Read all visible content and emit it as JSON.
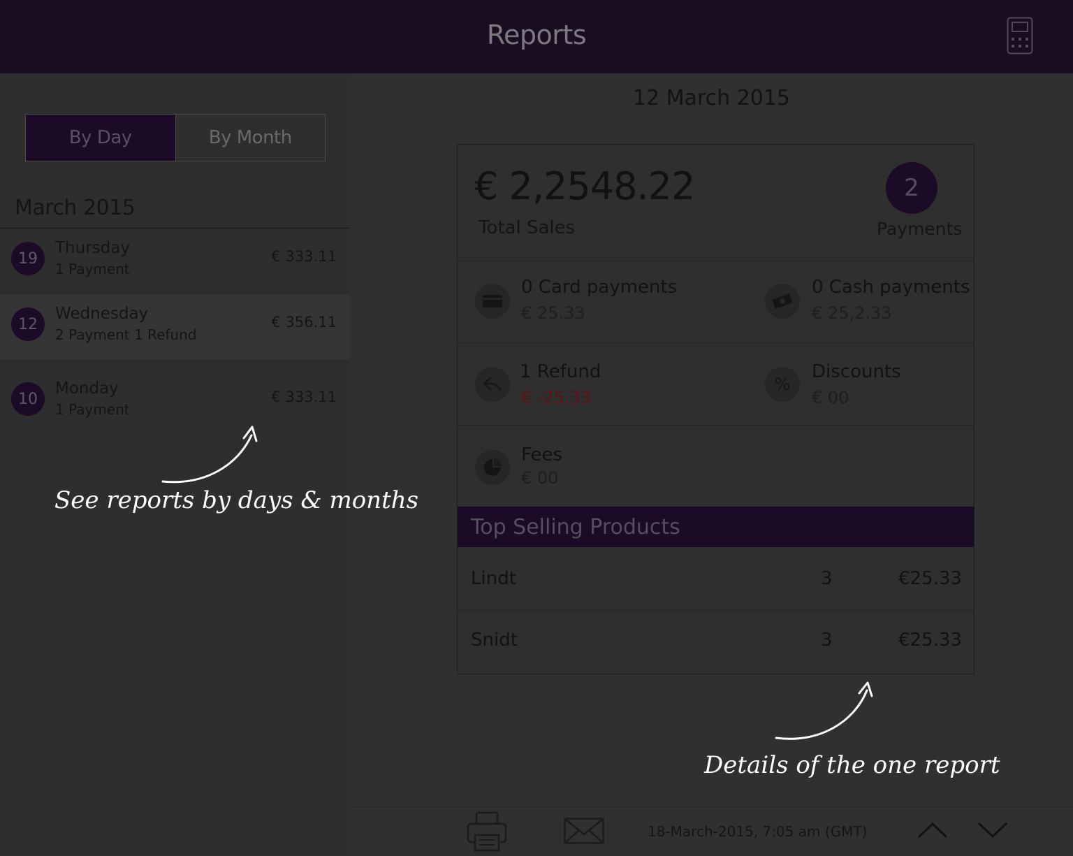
{
  "header": {
    "title": "Reports",
    "device_icon": "card-reader-icon"
  },
  "sidebar": {
    "toggle": {
      "by_day": "By Day",
      "by_month": "By Month",
      "active": "By Day"
    },
    "month": "March 2015",
    "days": [
      {
        "date": "19",
        "weekday": "Thursday",
        "summary": "1 Payment",
        "amount": "€ 333.11"
      },
      {
        "date": "12",
        "weekday": "Wednesday",
        "summary": "2 Payment 1 Refund",
        "amount": "€ 356.11"
      },
      {
        "date": "10",
        "weekday": "Monday",
        "summary": "1 Payment",
        "amount": "€ 333.11"
      }
    ],
    "annotation": "See reports by days & months"
  },
  "report": {
    "date": "12 March 2015",
    "total_amount": "€ 2,2548.22",
    "total_label": "Total Sales",
    "payments_count": "2",
    "payments_label": "Payments",
    "card": {
      "title": "0 Card payments",
      "value": "€ 25.33",
      "icon": "credit-card-icon"
    },
    "cash": {
      "title": "0 Cash payments",
      "value": "€ 25,2.33",
      "icon": "cash-icon"
    },
    "refund": {
      "title": "1 Refund",
      "value": "€ -25.33",
      "icon": "refund-arrow-icon",
      "value_color": "#5e1313"
    },
    "discounts": {
      "title": "Discounts",
      "value": "€ 00",
      "icon": "percent-icon"
    },
    "fees": {
      "title": "Fees",
      "value": "€ 00",
      "icon": "pie-chart-icon"
    },
    "top_selling_title": "Top Selling Products",
    "products": [
      {
        "name": "Lindt",
        "qty": "3",
        "price": "€25.33"
      },
      {
        "name": "Snidt",
        "qty": "3",
        "price": "€25.33"
      }
    ],
    "annotation": "Details of the one report"
  },
  "footer": {
    "timestamp": "18-March-2015, 7:05 am (GMT)",
    "print_icon": "printer-icon",
    "email_icon": "envelope-icon",
    "up_icon": "chevron-up-icon",
    "down_icon": "chevron-down-icon"
  },
  "colors": {
    "header_bg": "#1a0c21",
    "accent": "#1c0b26",
    "body_bg": "#303030"
  }
}
